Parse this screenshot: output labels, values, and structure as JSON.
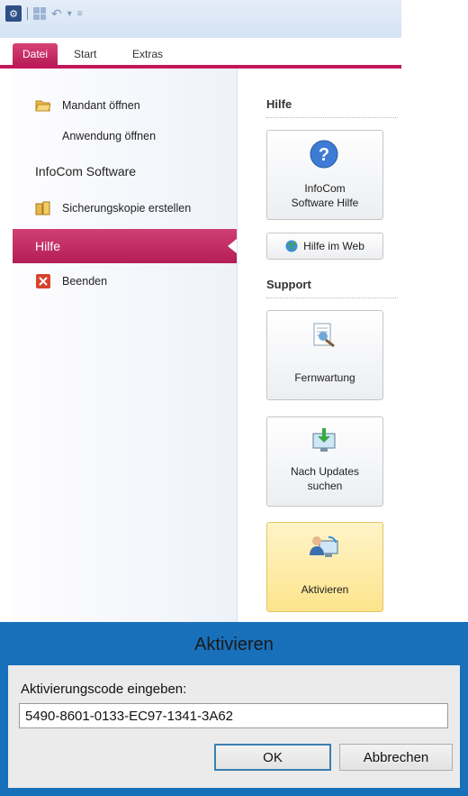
{
  "ribbon": {
    "tabs": [
      "Datei",
      "Start",
      "Extras"
    ]
  },
  "backstage": {
    "menu": {
      "mandant_oeffnen": "Mandant öffnen",
      "anwendung_oeffnen": "Anwendung öffnen",
      "infocom_software": "InfoCom Software",
      "sicherungskopie": "Sicherungskopie erstellen",
      "hilfe": "Hilfe",
      "beenden": "Beenden"
    },
    "hilfe_section": {
      "heading": "Hilfe",
      "software_hilfe_line1": "InfoCom",
      "software_hilfe_line2": "Software Hilfe",
      "hilfe_im_web": "Hilfe im Web"
    },
    "support_section": {
      "heading": "Support",
      "fernwartung": "Fernwartung",
      "updates_line1": "Nach Updates",
      "updates_line2": "suchen",
      "aktivieren": "Aktivieren"
    }
  },
  "dialog": {
    "title": "Aktivieren",
    "label": "Aktivierungscode eingeben:",
    "code_value": "5490-8601-0133-EC97-1341-3A62",
    "ok_label": "OK",
    "cancel_label": "Abbrechen"
  },
  "colors": {
    "accent": "#c2185b",
    "dialog_frame": "#1870ba"
  }
}
